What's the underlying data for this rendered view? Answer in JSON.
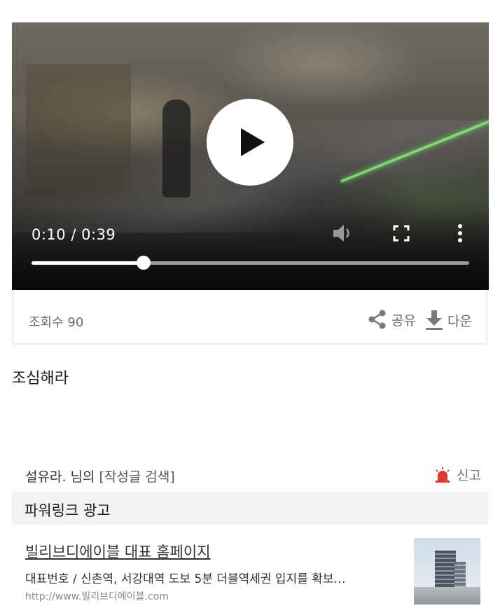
{
  "video": {
    "current_time": "0:10",
    "duration": "0:39",
    "time_display": "0:10 / 0:39",
    "progress_fraction": 0.2564
  },
  "info": {
    "views": "조회수 90",
    "share_label": "공유",
    "download_label": "다운"
  },
  "post": {
    "text": "조심해라"
  },
  "author": {
    "name": "설유라. 님의",
    "search_link": "[작성글 검색]",
    "report_label": "신고"
  },
  "ad": {
    "header": "파워링크 광고",
    "title": "빌리브디에이블 대표 홈페이지",
    "description": "대표번호 / 신촌역, 서강대역 도보 5분 더블역세권 입지를 확보…",
    "url": "http://www.빌리브디에이블.com"
  },
  "colors": {
    "report_icon": "#e03a2e",
    "icon_gray": "#7a7a7a"
  }
}
